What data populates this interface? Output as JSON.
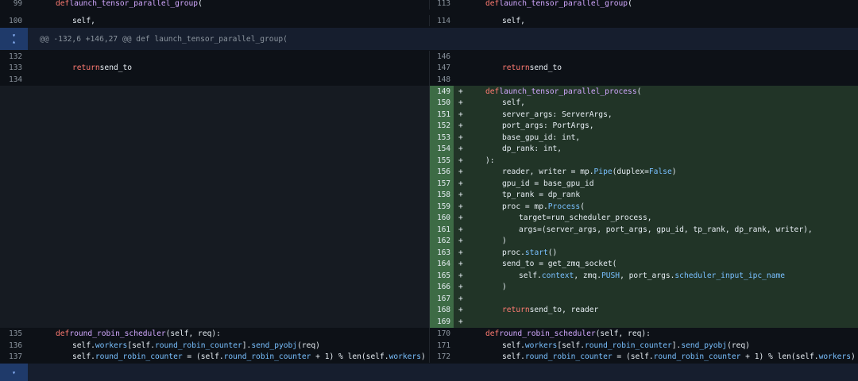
{
  "hunk_header": "@@ -132,6 +146,27 @@ def launch_tensor_parallel_group(",
  "icons": {
    "expand_up": "expand-up-icon",
    "expand_down": "expand-down-icon"
  },
  "colors": {
    "added_bg": "#213427",
    "added_gutter": "#3d6b45",
    "keyword": "#ff7b72",
    "function": "#d2a8ff",
    "attribute": "#79c0ff"
  },
  "top": [
    {
      "ln_left": "99",
      "ln_right": "113"
    },
    {
      "ln_left": "100",
      "ln_right": "114"
    }
  ],
  "mid": [
    {
      "ln_left": "132",
      "ln_right": "146"
    },
    {
      "ln_left": "133",
      "ln_right": "147"
    },
    {
      "ln_left": "134",
      "ln_right": "148"
    }
  ],
  "added": [
    {
      "ln": "149",
      "sign": "+"
    },
    {
      "ln": "150",
      "sign": "+"
    },
    {
      "ln": "151",
      "sign": "+"
    },
    {
      "ln": "152",
      "sign": "+"
    },
    {
      "ln": "153",
      "sign": "+"
    },
    {
      "ln": "154",
      "sign": "+"
    },
    {
      "ln": "155",
      "sign": "+"
    },
    {
      "ln": "156",
      "sign": "+"
    },
    {
      "ln": "157",
      "sign": "+"
    },
    {
      "ln": "158",
      "sign": "+"
    },
    {
      "ln": "159",
      "sign": "+"
    },
    {
      "ln": "160",
      "sign": "+"
    },
    {
      "ln": "161",
      "sign": "+"
    },
    {
      "ln": "162",
      "sign": "+"
    },
    {
      "ln": "163",
      "sign": "+"
    },
    {
      "ln": "164",
      "sign": "+"
    },
    {
      "ln": "165",
      "sign": "+"
    },
    {
      "ln": "166",
      "sign": "+"
    },
    {
      "ln": "167",
      "sign": "+"
    },
    {
      "ln": "168",
      "sign": "+"
    },
    {
      "ln": "169",
      "sign": "+"
    }
  ],
  "bottom": [
    {
      "ln_left": "135",
      "ln_right": "170"
    },
    {
      "ln_left": "136",
      "ln_right": "171"
    },
    {
      "ln_left": "137",
      "ln_right": "172"
    }
  ],
  "tokens": {
    "def": "def",
    "return": "return",
    "self": "self",
    "self_comma": "self,",
    "launch_group": "launch_tensor_parallel_group",
    "open_paren": "(",
    "send_to": "send_to",
    "launch_process": "launch_tensor_parallel_process",
    "server_args_line": "server_args: ServerArgs,",
    "port_args_line": "port_args: PortArgs,",
    "base_gpu_line": "base_gpu_id: int,",
    "dp_rank_line": "dp_rank: int,",
    "close_sig": "):",
    "reader_writer": "reader, writer = mp.",
    "Pipe": "Pipe",
    "duplex": "(duplex=",
    "False": "False",
    "close": ")",
    "gpu_id_line": "gpu_id = base_gpu_id",
    "tp_rank_line": "tp_rank = dp_rank",
    "proc_eq": "proc = mp.",
    "Process": "Process",
    "open": "(",
    "target_line": "target=run_scheduler_process,",
    "args_line": "args=(server_args, port_args, gpu_id, tp_rank, dp_rank, writer),",
    "proc_dot": "proc.",
    "start": "start",
    "empty_call": "()",
    "send_to_eq": "send_to = get_zmq_socket(",
    "self_dot": "self.",
    "context": "context",
    "zmq_push_a": ", zmq.",
    "PUSH": "PUSH",
    "port_args_dot": ", port_args.",
    "scheduler_input": "scheduler_input_ipc_name",
    "return_send_reader": "send_to, reader",
    "round_robin": "round_robin_scheduler",
    "rr_args": "(self, req):",
    "workers": "workers",
    "lbr": "[",
    "self_rrc": "self.",
    "rrc": "round_robin_counter",
    "rbr": "].",
    "send_pyobj": "send_pyobj",
    "req": "(req)",
    "rrc_eq": " = (self.",
    "plus1": " + 1) % len(self.",
    "close_only": ")"
  }
}
